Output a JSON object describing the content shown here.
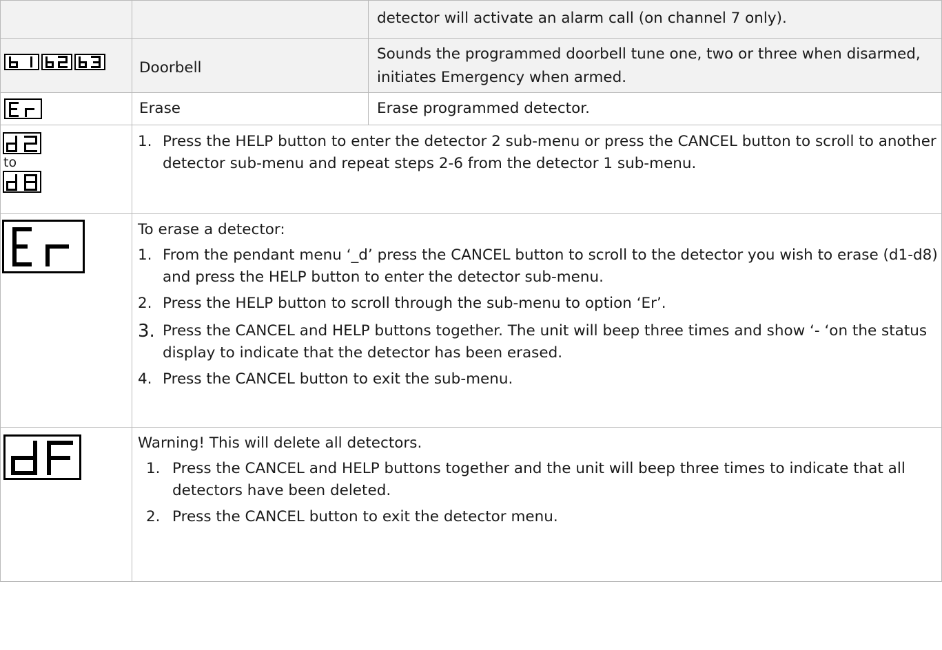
{
  "table": {
    "row0": {
      "description": "detector will activate an alarm call (on channel 7 only)."
    },
    "row1": {
      "display_codes": [
        "b1",
        "b2",
        "b3"
      ],
      "name": "Doorbell",
      "description": "Sounds the programmed doorbell tune one, two or three when disarmed, initiates Emergency when armed."
    },
    "row2": {
      "display_code": "Er",
      "name": "Erase",
      "description": "Erase programmed detector."
    },
    "row3": {
      "display_code_from": "d2",
      "range_word": "to",
      "display_code_to": "d8",
      "steps": [
        {
          "num": "1.",
          "text": "Press the HELP button to enter the detector 2 sub-menu or press the CANCEL button to scroll to another detector sub-menu and repeat steps 2-6 from the detector 1 sub-menu."
        }
      ]
    },
    "row4": {
      "display_code": "Er",
      "intro": "To erase a detector:",
      "steps": [
        {
          "num": "1.",
          "text": "From the pendant menu ‘_d’ press the CANCEL button to scroll to the detector you wish to erase (d1-d8) and press the HELP button to enter the detector sub-menu."
        },
        {
          "num": "2.",
          "text": "Press the HELP button to scroll through the sub-menu to option ‘Er’."
        },
        {
          "num": "3.",
          "text": "Press the CANCEL and HELP buttons together. The unit will beep three times and show ‘- ‘on the status display to indicate that the detector has been erased."
        },
        {
          "num": "4.",
          "text": "Press the CANCEL button to exit the sub-menu."
        }
      ]
    },
    "row5": {
      "display_code": "dF",
      "warning": "Warning! This will delete all detectors.",
      "steps": [
        {
          "num": "1.",
          "text": "Press the CANCEL and HELP buttons together and the unit will beep three times to indicate that all detectors have been deleted."
        },
        {
          "num": "2.",
          "text": "Press the CANCEL button to exit the detector menu."
        }
      ]
    }
  }
}
